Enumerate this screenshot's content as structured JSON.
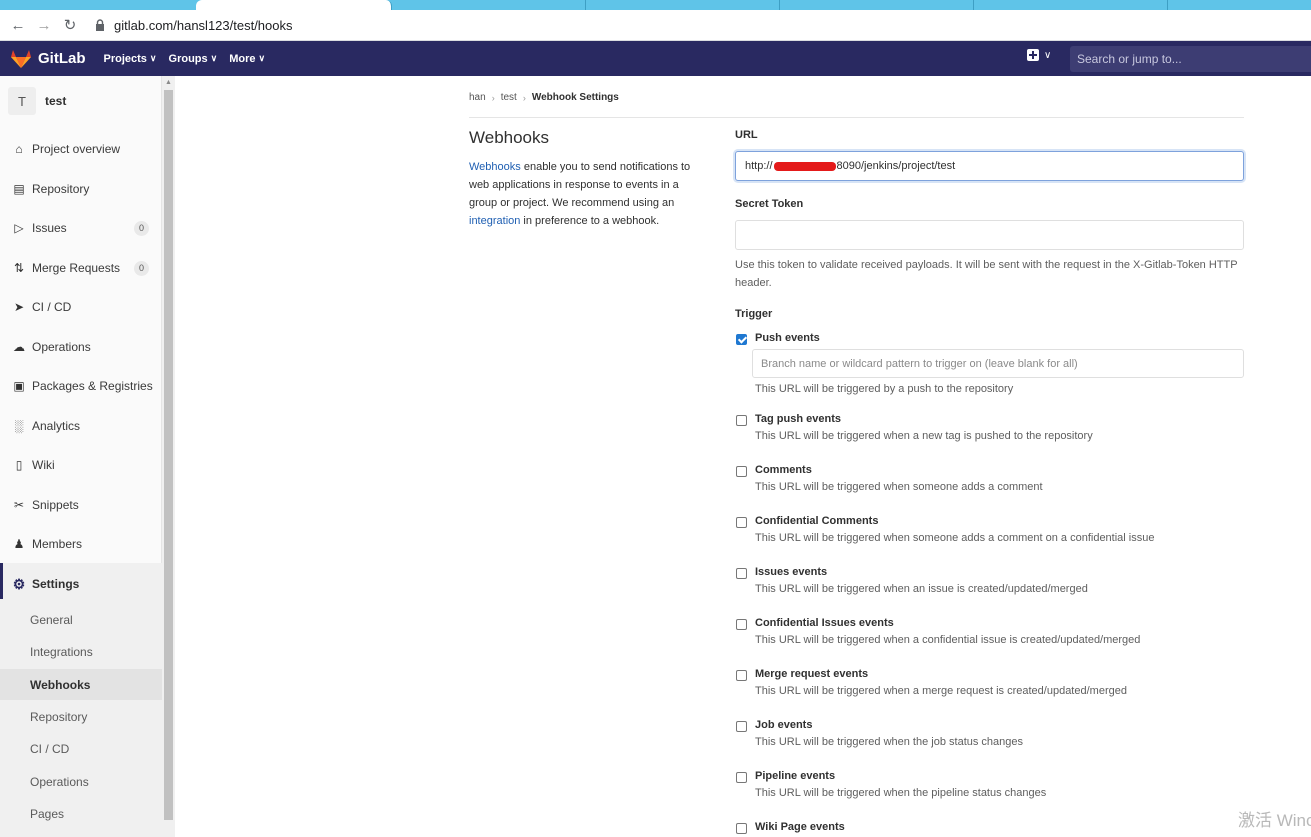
{
  "browser": {
    "url": "gitlab.com/hansl123/test/hooks"
  },
  "topnav": {
    "brand": "GitLab",
    "menus": [
      "Projects",
      "Groups",
      "More"
    ],
    "search_placeholder": "Search or jump to..."
  },
  "sidebar": {
    "project_initial": "T",
    "project_name": "test",
    "items": [
      {
        "label": "Project overview",
        "icon": "home-icon"
      },
      {
        "label": "Repository",
        "icon": "document-icon"
      },
      {
        "label": "Issues",
        "icon": "issues-icon",
        "badge": "0"
      },
      {
        "label": "Merge Requests",
        "icon": "merge-request-icon",
        "badge": "0"
      },
      {
        "label": "CI / CD",
        "icon": "rocket-icon"
      },
      {
        "label": "Operations",
        "icon": "cloud-gauge-icon"
      },
      {
        "label": "Packages & Registries",
        "icon": "package-icon"
      },
      {
        "label": "Analytics",
        "icon": "chart-icon"
      },
      {
        "label": "Wiki",
        "icon": "book-icon"
      },
      {
        "label": "Snippets",
        "icon": "scissors-icon"
      },
      {
        "label": "Members",
        "icon": "users-icon"
      }
    ],
    "settings_label": "Settings",
    "settings_sub": [
      "General",
      "Integrations",
      "Webhooks",
      "Repository",
      "CI / CD",
      "Operations",
      "Pages"
    ],
    "active_sub": "Webhooks"
  },
  "breadcrumb": [
    "han",
    "test",
    "Webhook Settings"
  ],
  "intro": {
    "title": "Webhooks",
    "link1": "Webhooks",
    "text1": " enable you to send notifications to web applications in response to events in a group or project. We recommend using an ",
    "link2": "integration",
    "text2": " in preference to a webhook."
  },
  "form": {
    "url_label": "URL",
    "url_prefix": "http://",
    "url_suffix": "8090/jenkins/project/test",
    "token_label": "Secret Token",
    "token_value": "",
    "token_help": "Use this token to validate received payloads. It will be sent with the request in the X-Gitlab-Token HTTP header.",
    "trigger_label": "Trigger",
    "branch_placeholder": "Branch name or wildcard pattern to trigger on (leave blank for all)",
    "events": [
      {
        "title": "Push events",
        "desc": "This URL will be triggered by a push to the repository",
        "checked": true
      },
      {
        "title": "Tag push events",
        "desc": "This URL will be triggered when a new tag is pushed to the repository",
        "checked": false
      },
      {
        "title": "Comments",
        "desc": "This URL will be triggered when someone adds a comment",
        "checked": false
      },
      {
        "title": "Confidential Comments",
        "desc": "This URL will be triggered when someone adds a comment on a confidential issue",
        "checked": false
      },
      {
        "title": "Issues events",
        "desc": "This URL will be triggered when an issue is created/updated/merged",
        "checked": false
      },
      {
        "title": "Confidential Issues events",
        "desc": "This URL will be triggered when a confidential issue is created/updated/merged",
        "checked": false
      },
      {
        "title": "Merge request events",
        "desc": "This URL will be triggered when a merge request is created/updated/merged",
        "checked": false
      },
      {
        "title": "Job events",
        "desc": "This URL will be triggered when the job status changes",
        "checked": false
      },
      {
        "title": "Pipeline events",
        "desc": "This URL will be triggered when the pipeline status changes",
        "checked": false
      },
      {
        "title": "Wiki Page events",
        "desc": "",
        "checked": false
      }
    ]
  },
  "watermark": "激活 Winc"
}
